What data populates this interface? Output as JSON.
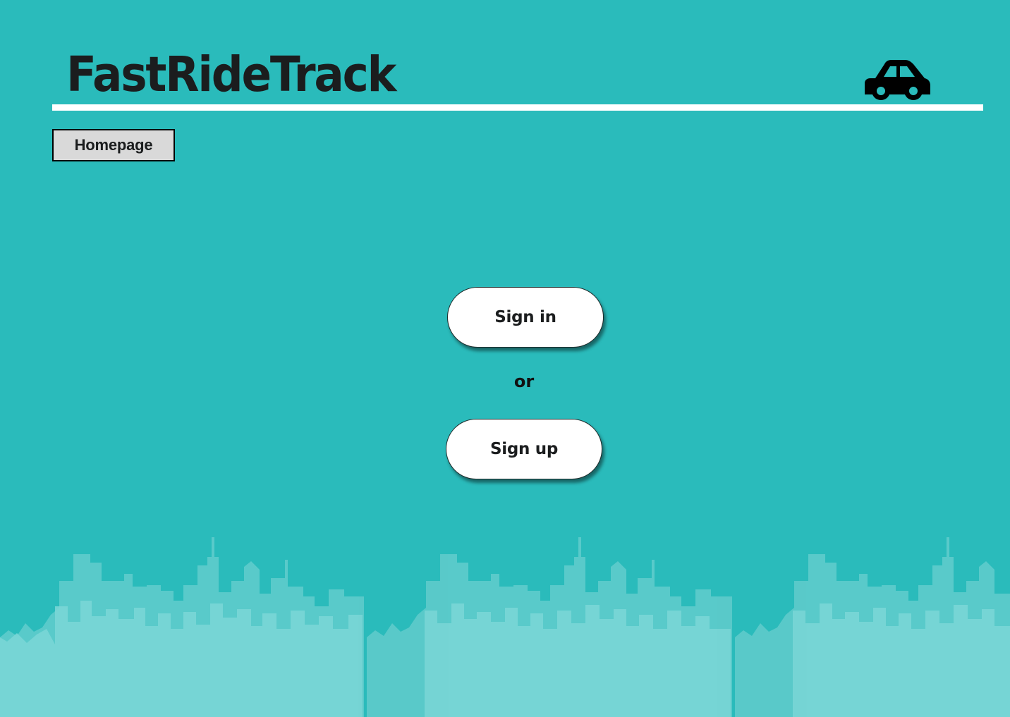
{
  "header": {
    "title": "FastRideTrack",
    "logo_icon": "car-icon"
  },
  "nav": {
    "homepage_label": "Homepage"
  },
  "auth": {
    "sign_in_label": "Sign in",
    "separator": "or",
    "sign_up_label": "Sign up"
  },
  "decor": {
    "background_icon": "city-skyline"
  },
  "colors": {
    "background": "#2abbbb",
    "skyline_back": "#5ccaca",
    "skyline_front": "#79d6d6",
    "text": "#1b1d1e",
    "tab_background": "#d9d9d9",
    "button_background": "#ffffff"
  }
}
